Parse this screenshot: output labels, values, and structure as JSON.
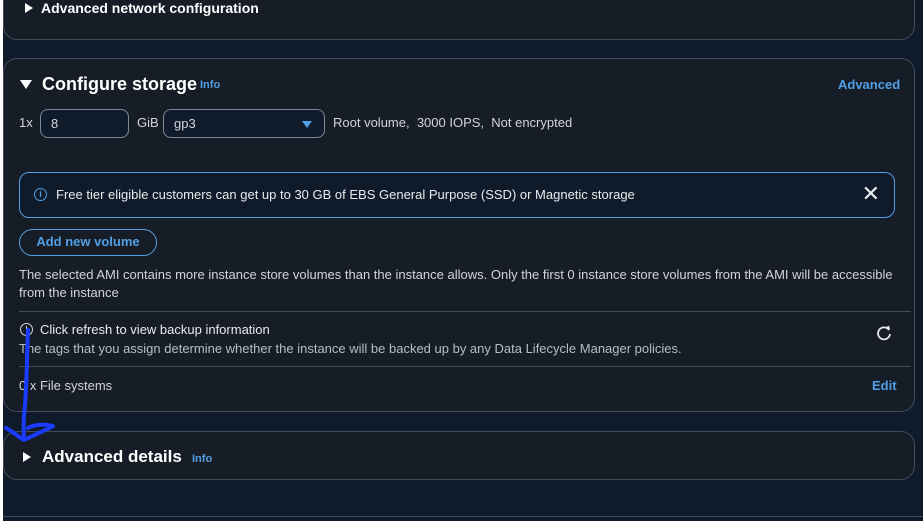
{
  "advanced_network": {
    "title": "Advanced network configuration"
  },
  "storage": {
    "title": "Configure storage",
    "info": "Info",
    "advanced_link": "Advanced",
    "volume": {
      "multiplier": "1x",
      "size": "8",
      "unit": "GiB",
      "type": "gp3",
      "summary": "Root volume,  3000 IOPS,  Not encrypted"
    },
    "alert": {
      "text": "Free tier eligible customers can get up to 30 GB of EBS General Purpose (SSD) or Magnetic storage"
    },
    "add_volume_button": "Add new volume",
    "ami_note": "The selected AMI contains more instance store volumes than the instance allows. Only the first 0 instance store volumes from the AMI will be accessible from the instance",
    "backup": {
      "title": "Click refresh to view backup information",
      "description": "The tags that you assign determine whether the instance will be backed up by any Data Lifecycle Manager policies."
    },
    "file_systems": {
      "count": "0 x File systems",
      "edit_link": "Edit"
    }
  },
  "advanced_details": {
    "title": "Advanced details",
    "info": "Info"
  },
  "colors": {
    "accent": "#539fe5",
    "annotation": "#1a3cff",
    "background": "#0f1b2a"
  }
}
